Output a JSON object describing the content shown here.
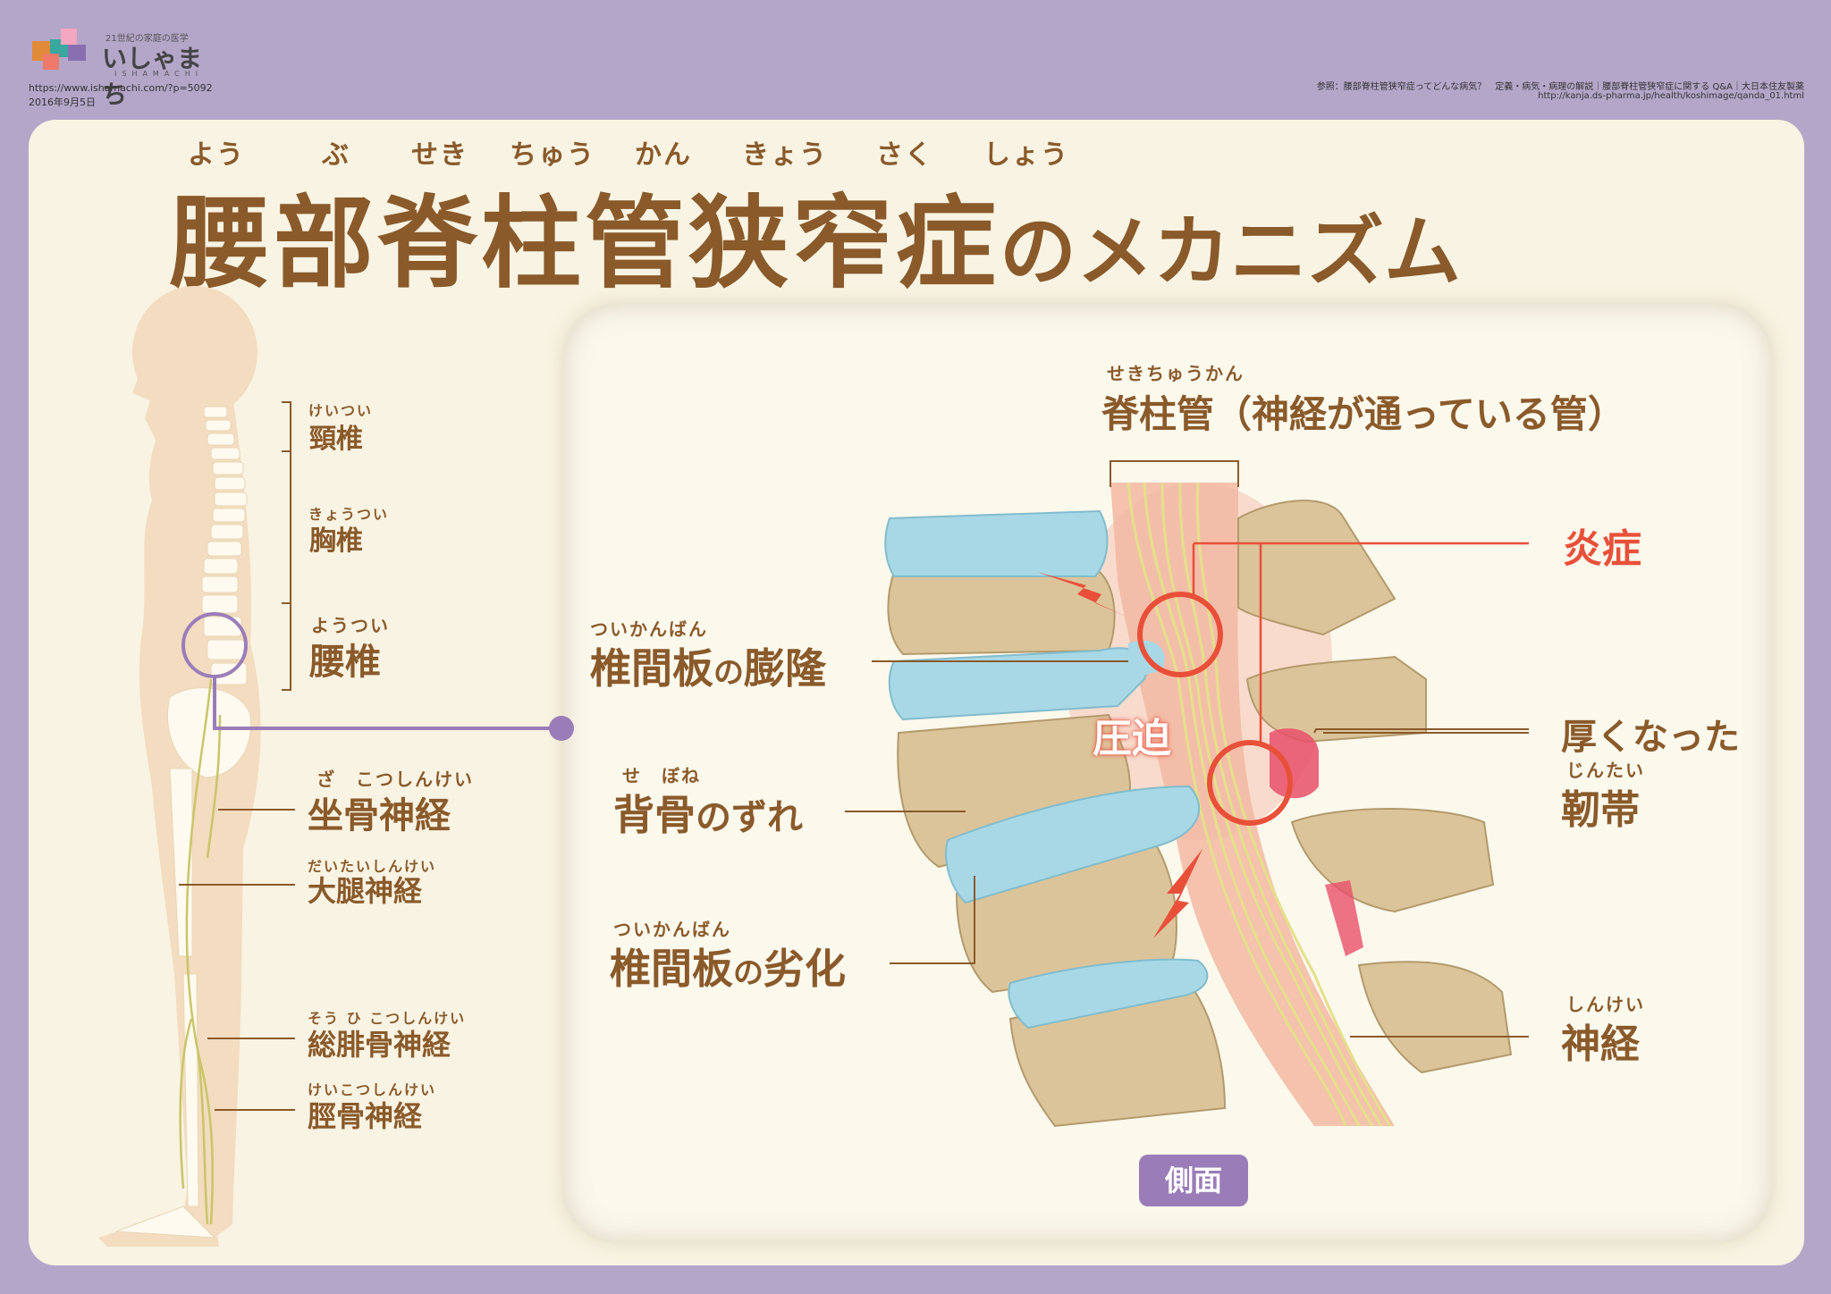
{
  "header": {
    "logo_tagline": "21世紀の家庭の医学",
    "logo_name": "いしゃまち",
    "logo_sub": "ISHAMACHI",
    "url": "https://www.ishamachi.com/?p=5092",
    "date": "2016年9月5日",
    "reference_line": "参照：腰部脊柱管狭窄症ってどんな病気？　定義・病気・病理の解説｜腰部脊柱管狭窄症に関する Q&A｜大日本住友製薬",
    "reference_url": "http://kanja.ds-pharma.jp/health/koshimage/qanda_01.html"
  },
  "title": {
    "ruby": [
      "よう",
      "ぶ",
      "せき",
      "ちゅう",
      "かん",
      "きょう",
      "さく",
      "しょう"
    ],
    "main": "腰部脊柱管狭窄症",
    "suffix": "のメカニズム"
  },
  "body_labels": {
    "cervical": {
      "ruby": "けいつい",
      "text": "頸椎"
    },
    "thoracic": {
      "ruby": "きょうつい",
      "text": "胸椎"
    },
    "lumbar": {
      "ruby": "ようつい",
      "text": "腰椎"
    },
    "sciatic": {
      "ruby": "ざ　こつしんけい",
      "text": "坐骨神経"
    },
    "femoral": {
      "ruby": "だいたいしんけい",
      "text": "大腿神経"
    },
    "peroneal": {
      "ruby": "そう ひ こつしんけい",
      "text": "総腓骨神経"
    },
    "tibial": {
      "ruby": "けいこつしんけい",
      "text": "脛骨神経"
    }
  },
  "detail_labels": {
    "canal": {
      "ruby": "せきちゅうかん",
      "text": "脊柱管（神経が通っている管）"
    },
    "inflammation": {
      "text": "炎症"
    },
    "disc_bulge": {
      "ruby": "ついかんばん",
      "text_a": "椎間板",
      "text_b": "の",
      "text_c": "膨隆"
    },
    "compression": {
      "text": "圧迫"
    },
    "slip": {
      "ruby": "せ　ぼね",
      "text_a": "背骨",
      "text_b": "のずれ"
    },
    "degeneration": {
      "ruby": "ついかんばん",
      "text_a": "椎間板",
      "text_b": "の",
      "text_c": "劣化"
    },
    "ligament": {
      "line1": "厚くなった",
      "ruby": "じんたい",
      "text": "靭帯"
    },
    "nerve": {
      "ruby": "しんけい",
      "text": "神経"
    },
    "view_badge": "側面"
  },
  "colors": {
    "background": "#b4a6c9",
    "card": "#f8f3e2",
    "text_brown": "#8a5a2b",
    "accent_red": "#e8503a",
    "accent_purple": "#9a7db8",
    "bone": "#dcc49a",
    "disc": "#a8d8e6",
    "skin": "#f3dcc0"
  }
}
